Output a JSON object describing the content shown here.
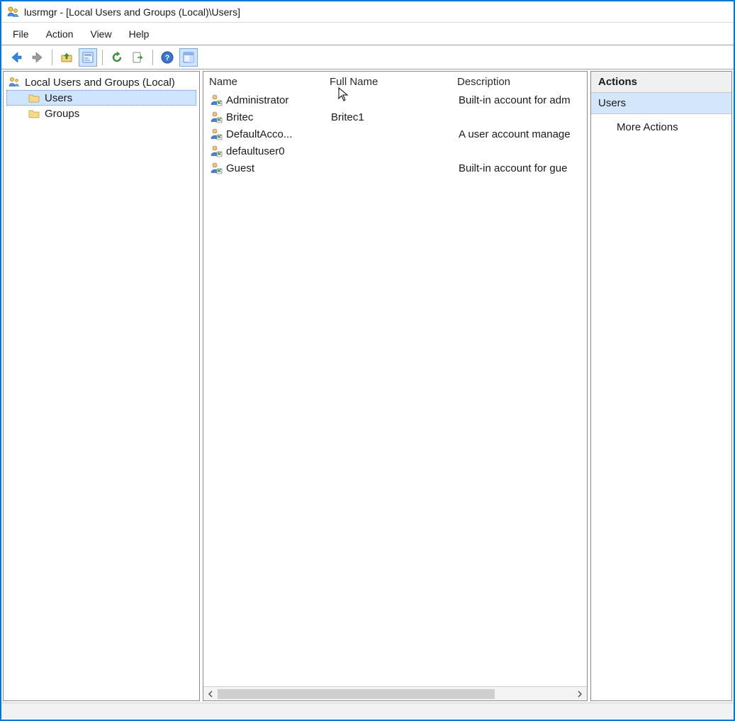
{
  "window": {
    "title": "lusrmgr - [Local Users and Groups (Local)\\Users]"
  },
  "menubar": {
    "items": [
      {
        "label": "File"
      },
      {
        "label": "Action"
      },
      {
        "label": "View"
      },
      {
        "label": "Help"
      }
    ]
  },
  "tree": {
    "root_label": "Local Users and Groups (Local)",
    "items": [
      {
        "label": "Users",
        "selected": true
      },
      {
        "label": "Groups",
        "selected": false
      }
    ]
  },
  "list": {
    "columns": {
      "name": "Name",
      "full_name": "Full Name",
      "description": "Description"
    },
    "rows": [
      {
        "name": "Administrator",
        "full_name": "",
        "description": "Built-in account for adm"
      },
      {
        "name": "Britec",
        "full_name": "Britec1",
        "description": ""
      },
      {
        "name": "DefaultAcco...",
        "full_name": "",
        "description": "A user account manage"
      },
      {
        "name": "defaultuser0",
        "full_name": "",
        "description": ""
      },
      {
        "name": "Guest",
        "full_name": "",
        "description": "Built-in account for gue"
      }
    ]
  },
  "actions": {
    "header": "Actions",
    "section": "Users",
    "items": [
      {
        "label": "More Actions"
      }
    ]
  }
}
